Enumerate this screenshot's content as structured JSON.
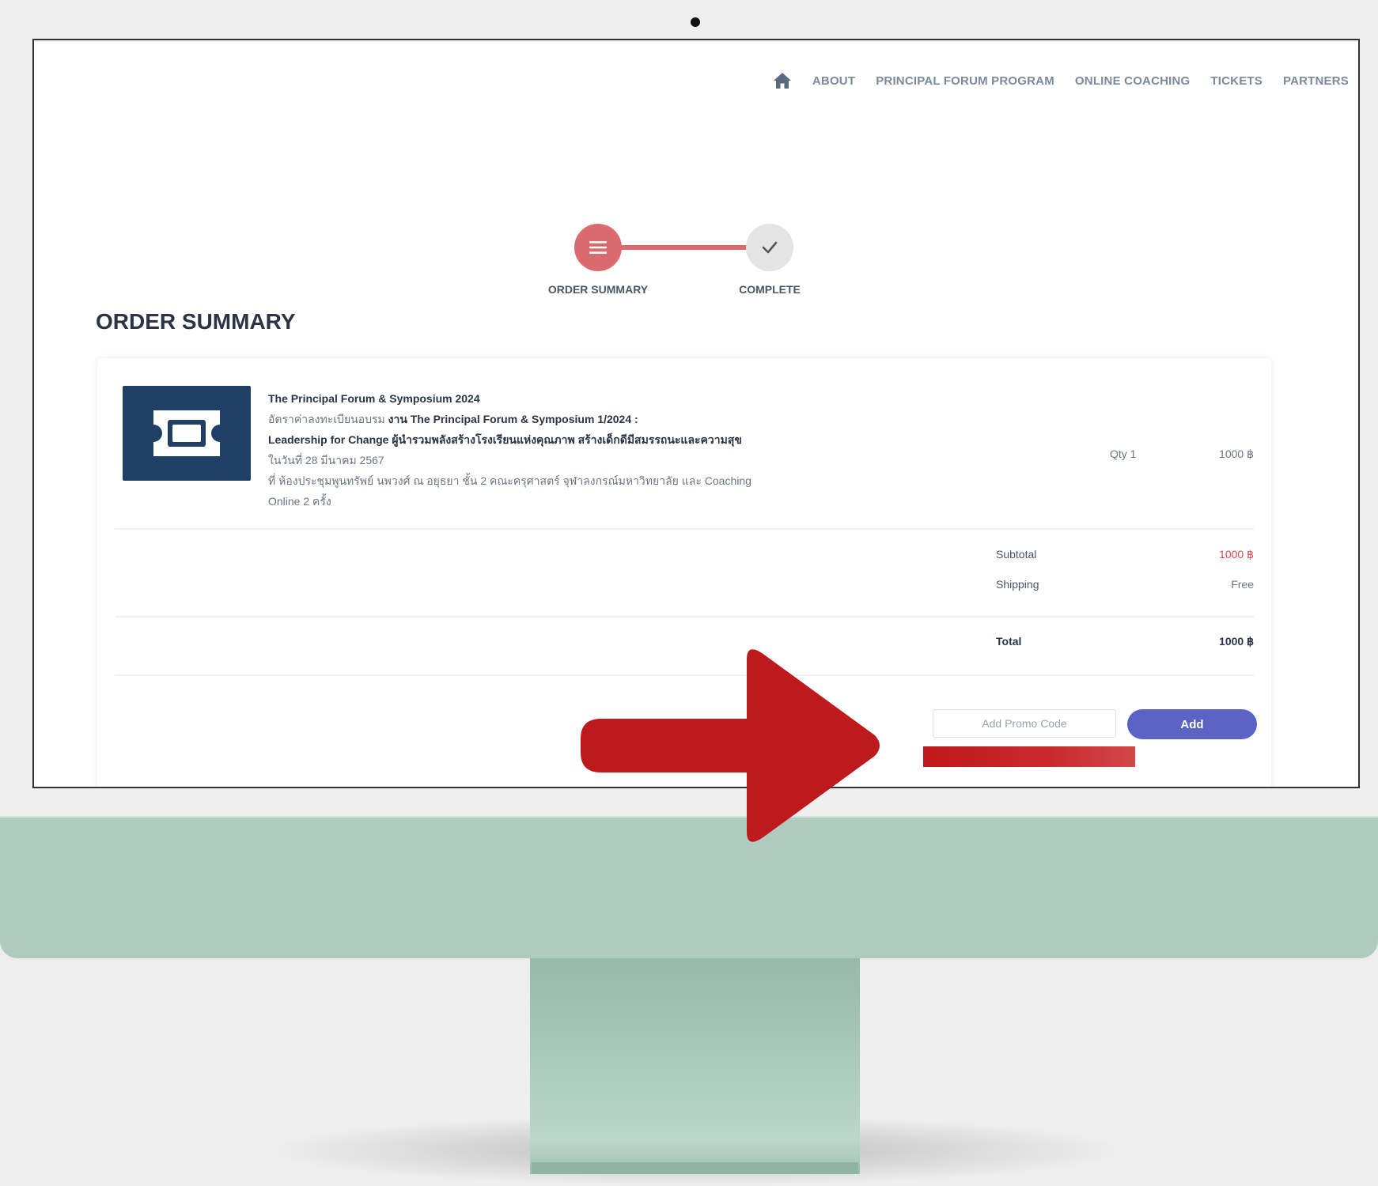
{
  "nav": {
    "items": [
      {
        "label": "ABOUT"
      },
      {
        "label": "PRINCIPAL FORUM PROGRAM"
      },
      {
        "label": "ONLINE COACHING"
      },
      {
        "label": "TICKETS"
      },
      {
        "label": "PARTNERS"
      }
    ],
    "home_icon": "home-icon"
  },
  "stepper": {
    "steps": [
      {
        "label": "ORDER SUMMARY",
        "icon": "menu-icon",
        "active": true
      },
      {
        "label": "COMPLETE",
        "icon": "checkmark-icon",
        "active": false
      }
    ],
    "active_color": "#d96a6e"
  },
  "page": {
    "title": "ORDER SUMMARY"
  },
  "item": {
    "icon": "ticket-icon",
    "title": "The Principal Forum & Symposium 2024",
    "line1_prefix": "อัตราค่าลงทะเบียนอบรม",
    "line1_bold": "งาน The Principal Forum & Symposium 1/2024 :",
    "line2_bold": "Leadership for Change ผู้นำรวมพลังสร้างโรงเรียนแห่งคุณภาพ สร้างเด็กดีมีสมรรถนะและความสุข",
    "line3": "ในวันที่ 28 มีนาคม 2567",
    "line4": "ที่ ห้องประชุมพูนทรัพย์ นพวงศ์ ณ อยุธยา ชั้น 2 คณะครุศาสตร์ จุฬาลงกรณ์มหาวิทยาลัย และ Coaching",
    "line5": "Online 2 ครั้ง",
    "qty": "Qty 1",
    "price": "1000 ฿"
  },
  "summary": {
    "subtotal_label": "Subtotal",
    "subtotal_value": "1000 ฿",
    "shipping_label": "Shipping",
    "shipping_value": "Free",
    "total_label": "Total",
    "total_value": "1000 ฿"
  },
  "promo": {
    "placeholder": "Add Promo Code",
    "button_label": "Add",
    "button_color": "#5b64c4"
  },
  "overlay": {
    "arrow_color": "#be1a1d",
    "arrow_icon": "arrow-right-icon"
  },
  "device": {
    "chin_color": "#afcbbf"
  }
}
